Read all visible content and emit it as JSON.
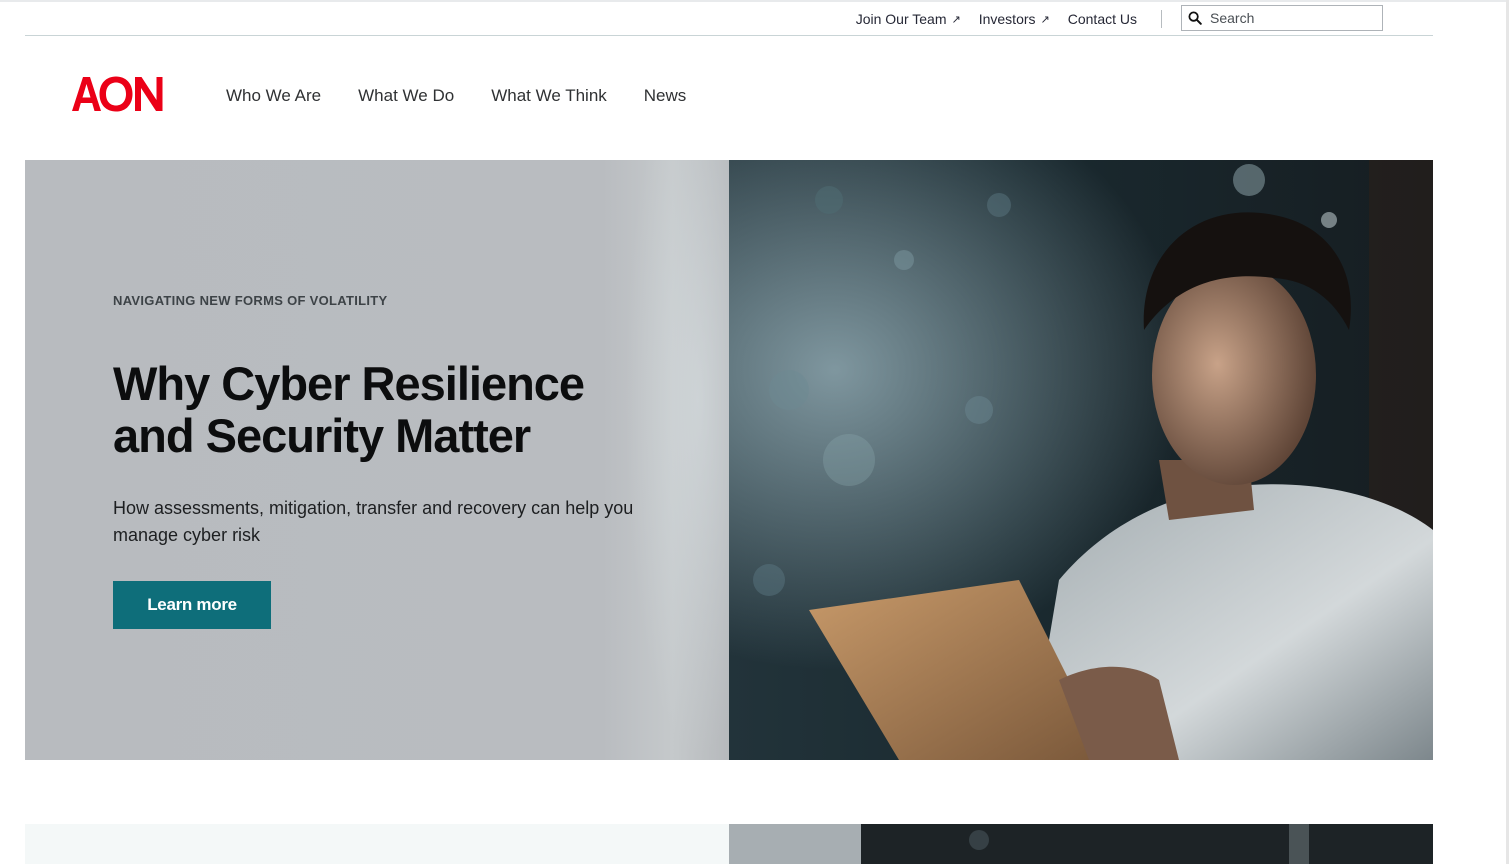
{
  "utility_nav": {
    "links": [
      {
        "label": "Join Our Team",
        "external": true
      },
      {
        "label": "Investors",
        "external": true
      },
      {
        "label": "Contact Us",
        "external": false
      }
    ],
    "search": {
      "placeholder": "Search",
      "icon": "search-icon"
    }
  },
  "brand": {
    "logo_text": "AON",
    "color": "#eb0017"
  },
  "main_nav": {
    "items": [
      "Who We Are",
      "What We Do",
      "What We Think",
      "News"
    ]
  },
  "hero": {
    "eyebrow": "NAVIGATING NEW FORMS OF VOLATILITY",
    "title": "Why Cyber Resilience and Security Matter",
    "description": "How assessments, mitigation, transfer and recovery can help you manage cyber risk",
    "cta_label": "Learn more",
    "cta_color": "#0e6e7a",
    "image": "man-using-tablet-in-dark-office-photo"
  }
}
